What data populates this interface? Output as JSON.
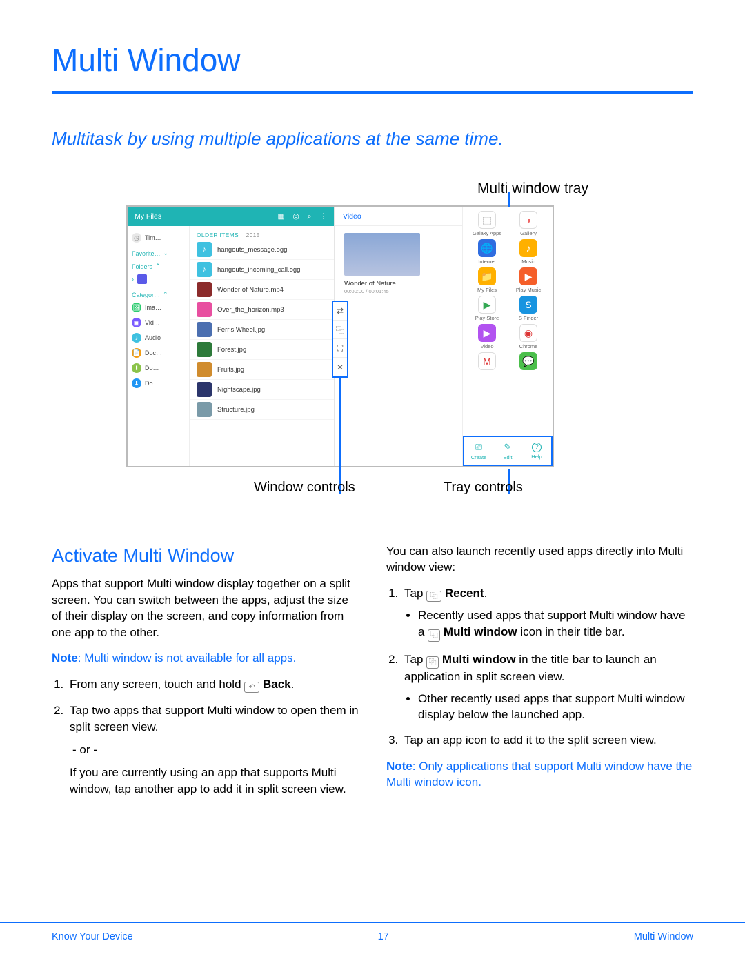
{
  "title": "Multi Window",
  "subtitle": "Multitask by using multiple applications at the same time.",
  "figure": {
    "captions": {
      "tray": "Multi window tray",
      "window_controls": "Window controls",
      "tray_controls": "Tray controls"
    },
    "myfiles": {
      "header_title": "My Files",
      "sidebar": {
        "recent": "Tim…",
        "favorites_heading": "Favorite…",
        "folders_heading": "Folders",
        "categories_heading": "Categor…",
        "cats": [
          "Ima…",
          "Vid…",
          "Audio",
          "Doc…",
          "Do…",
          "Do…"
        ]
      },
      "older_label": "OLDER ITEMS",
      "older_year": "2015",
      "files": [
        {
          "name": "hangouts_message.ogg",
          "color": "#3fc1e0",
          "glyph": "♪"
        },
        {
          "name": "hangouts_incoming_call.ogg",
          "color": "#3fc1e0",
          "glyph": "♪"
        },
        {
          "name": "Wonder of Nature.mp4",
          "color": "#8b2b2b",
          "glyph": ""
        },
        {
          "name": "Over_the_horizon.mp3",
          "color": "#e84fa0",
          "glyph": ""
        },
        {
          "name": "Ferris Wheel.jpg",
          "color": "#4b6fb0",
          "glyph": ""
        },
        {
          "name": "Forest.jpg",
          "color": "#2d7a3a",
          "glyph": ""
        },
        {
          "name": "Fruits.jpg",
          "color": "#d08c2e",
          "glyph": ""
        },
        {
          "name": "Nightscape.jpg",
          "color": "#2b356b",
          "glyph": ""
        },
        {
          "name": "Structure.jpg",
          "color": "#7a9aa8",
          "glyph": ""
        }
      ]
    },
    "video": {
      "header": "Video",
      "title": "Wonder of Nature",
      "time": "00:00:00 / 00:01:45"
    },
    "window_controls": [
      "⇄",
      "⿻",
      "⛶",
      "✕"
    ],
    "tray_apps": [
      {
        "label": "Galaxy Apps",
        "color": "#fff",
        "glyph": "⬚",
        "fg": "#555"
      },
      {
        "label": "Gallery",
        "color": "#fff",
        "glyph": "◑",
        "fg": "#e66"
      },
      {
        "label": "Internet",
        "color": "#2f6de0",
        "glyph": "🌐"
      },
      {
        "label": "Music",
        "color": "#ffb000",
        "glyph": "♪"
      },
      {
        "label": "My Files",
        "color": "#ffb000",
        "glyph": "📁"
      },
      {
        "label": "Play Music",
        "color": "#f55f2a",
        "glyph": "▶"
      },
      {
        "label": "Play Store",
        "color": "#fff",
        "glyph": "▶",
        "fg": "#34a853"
      },
      {
        "label": "S Finder",
        "color": "#1894e0",
        "glyph": "S"
      },
      {
        "label": "Video",
        "color": "#b253f0",
        "glyph": "▶"
      },
      {
        "label": "Chrome",
        "color": "#fff",
        "glyph": "◉",
        "fg": "#d33"
      },
      {
        "label": "",
        "color": "#fff",
        "glyph": "M",
        "fg": "#d33"
      },
      {
        "label": "",
        "color": "#4bbf4b",
        "glyph": "💬"
      }
    ],
    "tray_controls": [
      {
        "label": "Create",
        "glyph": "⎚"
      },
      {
        "label": "Edit",
        "glyph": "✎"
      },
      {
        "label": "Help",
        "glyph": "?"
      }
    ]
  },
  "section_heading": "Activate Multi Window",
  "left_col": {
    "intro": "Apps that support Multi window display together on a split screen. You can switch between the apps, adjust the size of their display on the screen, and copy information from one app to the other.",
    "note_label": "Note",
    "note_text": ": Multi window is not available for all apps.",
    "step1_prefix": "From any screen, touch and hold ",
    "step1_bold": "Back",
    "step1_suffix": ".",
    "step2": "Tap two apps that support Multi window to open them in split screen view.",
    "or": "- or -",
    "step2_alt": "If you are currently using an app that supports Multi window, tap another app to add it in split screen view."
  },
  "right_col": {
    "intro": "You can also launch recently used apps directly into Multi window view:",
    "s1_prefix": "Tap ",
    "s1_bold": "Recent",
    "s1_suffix": ".",
    "s1_b1a": "Recently used apps that support Multi window have a ",
    "s1_b1_bold": "Multi window",
    "s1_b1b": " icon in their title bar.",
    "s2_prefix": "Tap ",
    "s2_bold": "Multi window",
    "s2_suffix": " in the title bar to launch an application in split screen view.",
    "s2_b1": "Other recently used apps that support Multi window display below the launched app.",
    "s3": "Tap an app icon to add it to the split screen view.",
    "note_label": "Note",
    "note_text": ": Only applications that support Multi window have the Multi window icon."
  },
  "footer": {
    "left": "Know Your Device",
    "center": "17",
    "right": "Multi Window"
  }
}
